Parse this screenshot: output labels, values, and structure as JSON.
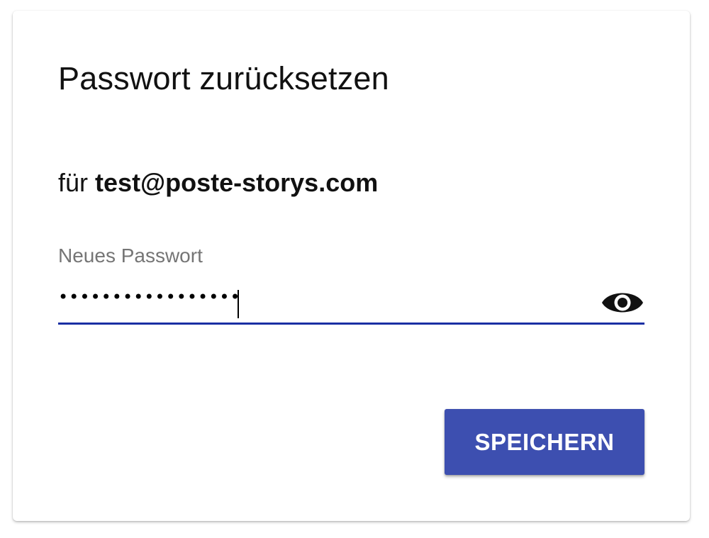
{
  "dialog": {
    "title": "Passwort zurücksetzen",
    "subtitle_prefix": "für",
    "email": "test@poste-storys.com"
  },
  "password_field": {
    "label": "Neues Passwort",
    "value": "•••••••••••••••••",
    "toggle_icon": "eye-icon"
  },
  "actions": {
    "save_label": "SPEICHERN"
  },
  "colors": {
    "accent": "#3d4fb0",
    "underline": "#1a2fa3",
    "label": "#757575"
  }
}
